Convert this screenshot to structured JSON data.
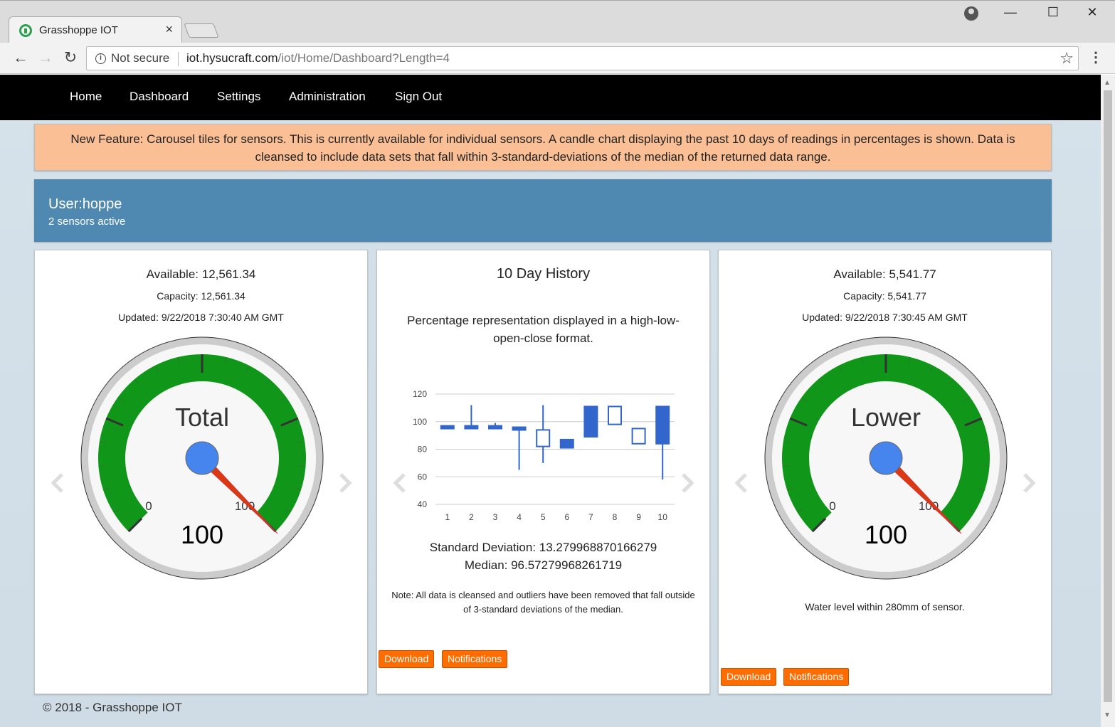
{
  "browser": {
    "tab_title": "Grasshoppe IOT",
    "tab_close": "×",
    "security_label": "Not secure",
    "url_host": "iot.hysucraft.com",
    "url_path": "/iot/Home/Dashboard?Length=4",
    "back": "←",
    "forward": "→",
    "reload": "↻",
    "star": "☆",
    "menu": "⋮",
    "minimize": "—",
    "maximize": "☐",
    "close": "✕"
  },
  "nav": {
    "items": [
      "Home",
      "Dashboard",
      "Settings",
      "Administration",
      "Sign Out"
    ]
  },
  "alert": {
    "text": "New Feature: Carousel tiles for sensors. This is currently available for individual sensors. A candle chart displaying the past 10 days of readings in percentages is shown. Data is cleansed to include data sets that fall within 3-standard-deviations of the median of the returned data range."
  },
  "user": {
    "name": "User:hoppe",
    "sensors": "2 sensors active"
  },
  "panel_total": {
    "available": "Available: 12,561.34",
    "capacity": "Capacity: 12,561.34",
    "updated": "Updated: 9/22/2018 7:30:40 AM GMT",
    "gauge_label": "Total",
    "gauge_value": "100",
    "gauge_min": "0",
    "gauge_max": "100",
    "value": 100
  },
  "panel_history": {
    "title": "10 Day History",
    "description": "Percentage representation displayed in a high-low-open-close format.",
    "std_dev": "Standard Deviation: 13.279968870166279",
    "median": "Median: 96.57279968261719",
    "note": "Note: All data is cleansed and outliers have been removed that fall outside of 3-standard deviations of the median.",
    "download": "Download",
    "notifications": "Notifications"
  },
  "panel_lower": {
    "available": "Available: 5,541.77",
    "capacity": "Capacity: 5,541.77",
    "updated": "Updated: 9/22/2018 7:30:45 AM GMT",
    "gauge_label": "Lower",
    "gauge_value": "100",
    "gauge_min": "0",
    "gauge_max": "100",
    "value": 100,
    "water_note": "Water level within 280mm of sensor.",
    "download": "Download",
    "notifications": "Notifications"
  },
  "chart_data": {
    "type": "candlestick",
    "x": [
      1,
      2,
      3,
      4,
      5,
      6,
      7,
      8,
      9,
      10
    ],
    "ylim": [
      40,
      120
    ],
    "yticks": [
      40,
      60,
      80,
      100,
      120
    ],
    "candles": [
      {
        "x": 1,
        "low": 95,
        "open": 97,
        "close": 95,
        "high": 97
      },
      {
        "x": 2,
        "low": 95,
        "open": 97,
        "close": 95,
        "high": 112
      },
      {
        "x": 3,
        "low": 95,
        "open": 97,
        "close": 95,
        "high": 99
      },
      {
        "x": 4,
        "low": 65,
        "open": 96,
        "close": 95,
        "high": 96
      },
      {
        "x": 5,
        "low": 70,
        "open": 82,
        "close": 94,
        "high": 112
      },
      {
        "x": 6,
        "low": 81,
        "open": 87,
        "close": 81,
        "high": 87
      },
      {
        "x": 7,
        "low": 89,
        "open": 111,
        "close": 89,
        "high": 111
      },
      {
        "x": 8,
        "low": 98,
        "open": 98,
        "close": 111,
        "high": 111
      },
      {
        "x": 9,
        "low": 84,
        "open": 84,
        "close": 95,
        "high": 95
      },
      {
        "x": 10,
        "low": 58,
        "open": 111,
        "close": 84,
        "high": 111
      }
    ],
    "color": "#3366cc",
    "grid": true
  },
  "colors": {
    "navbar": "#000000",
    "alert": "#fbbf95",
    "userbar": "#4f88b0",
    "gauge_green": "#109618",
    "needle": "#dc3912",
    "needle_hub": "#4684ee",
    "button": "#ff6c00"
  },
  "footer": {
    "text": "© 2018 - Grasshoppe IOT"
  }
}
